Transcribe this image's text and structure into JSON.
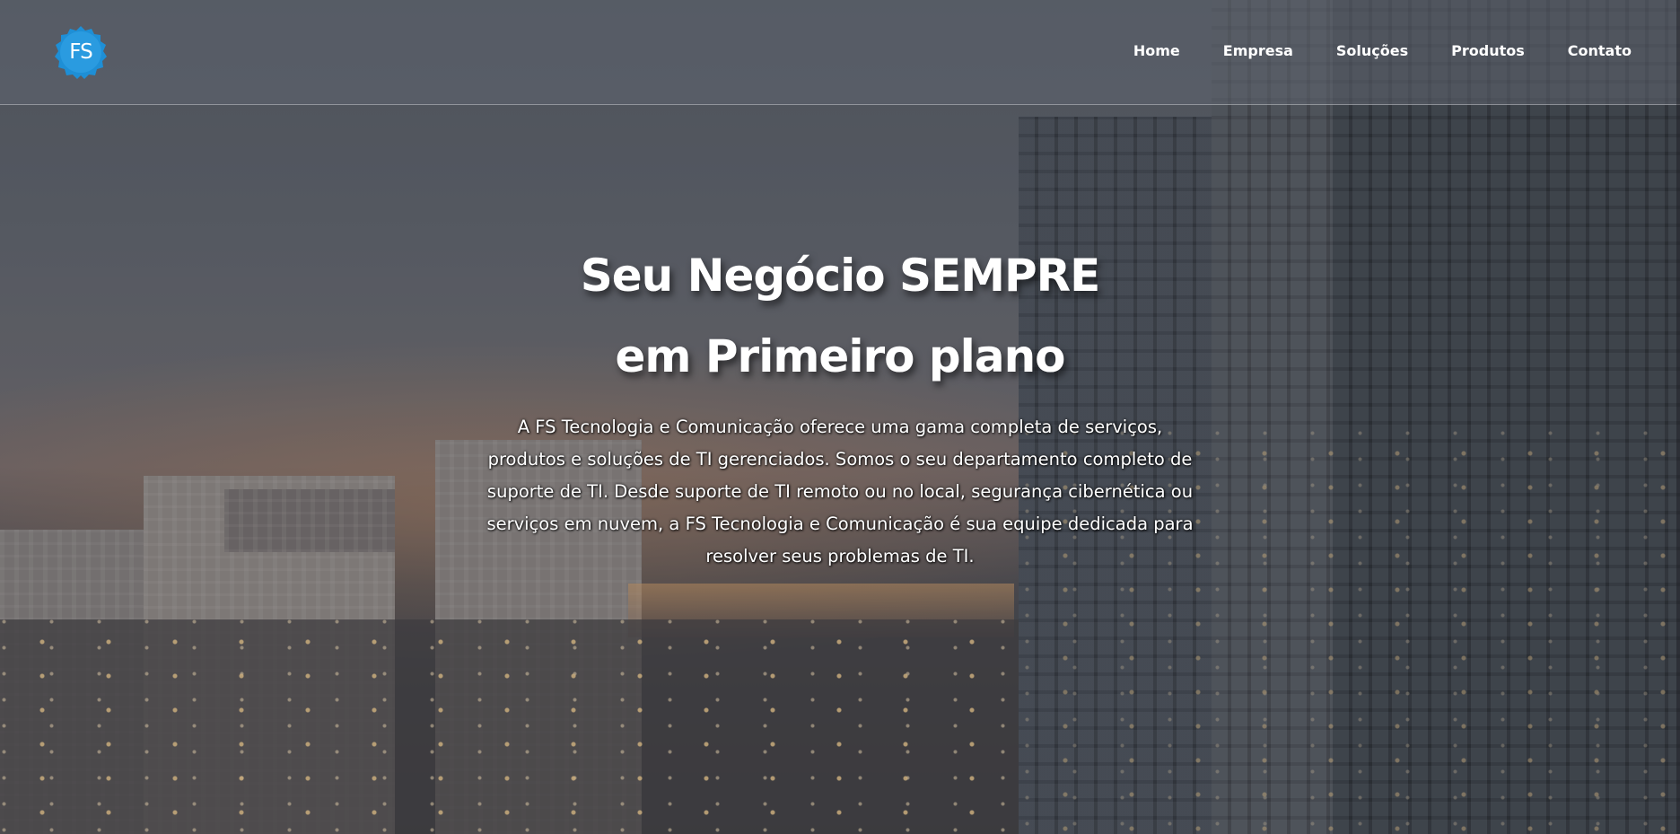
{
  "brand": {
    "logo_text": "FS",
    "accent": "#1e8fd6"
  },
  "nav": {
    "items": [
      {
        "label": "Home"
      },
      {
        "label": "Empresa"
      },
      {
        "label": "Soluções"
      },
      {
        "label": "Produtos"
      },
      {
        "label": "Contato"
      }
    ]
  },
  "hero": {
    "title_line1": "Seu Negócio SEMPRE",
    "title_line2": "em Primeiro plano",
    "description": "A FS Tecnologia e Comunicação oferece uma gama completa de serviços, produtos e soluções de TI gerenciados. Somos o seu departamento completo de suporte de TI. Desde suporte de TI remoto ou no local, segurança cibernética ou serviços em nuvem, a FS Tecnologia e Comunicação é sua equipe dedicada para resolver seus problemas de TI."
  }
}
